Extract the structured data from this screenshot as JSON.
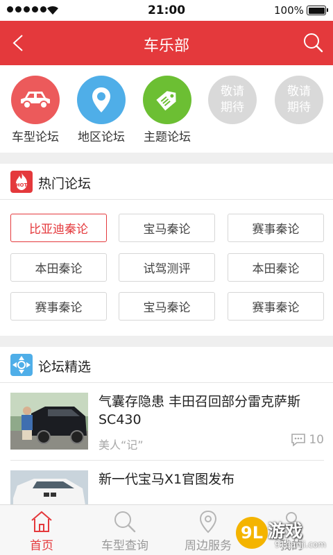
{
  "status_bar": {
    "time": "21:00",
    "battery_percent": "100%",
    "signal_icon": "signal-dots-icon",
    "wifi_icon": "wifi-icon"
  },
  "nav_bar": {
    "title": "车乐部",
    "back_icon": "chevron-left-icon",
    "search_icon": "search-icon",
    "color": "#e4393c"
  },
  "categories": [
    {
      "label": "车型论坛",
      "icon": "car-icon",
      "color": "#ec5a5b"
    },
    {
      "label": "地区论坛",
      "icon": "location-pin-icon",
      "color": "#4faee8"
    },
    {
      "label": "主题论坛",
      "icon": "tag-icon",
      "color": "#6cbf33"
    },
    {
      "label": "敬请期待",
      "line1": "敬请",
      "line2": "期待",
      "icon": "placeholder",
      "color": "#d9d9d9"
    },
    {
      "label": "敬请期待",
      "line1": "敬请",
      "line2": "期待",
      "icon": "placeholder",
      "color": "#d9d9d9"
    }
  ],
  "hot_forums": {
    "title": "热门论坛",
    "icon": "hot-badge-icon",
    "icon_text": "HOT",
    "tags": [
      {
        "label": "比亚迪秦论",
        "active": true
      },
      {
        "label": "宝马秦论",
        "active": false
      },
      {
        "label": "赛事秦论",
        "active": false
      },
      {
        "label": "本田秦论",
        "active": false
      },
      {
        "label": "试驾测评",
        "active": false
      },
      {
        "label": "本田秦论",
        "active": false
      },
      {
        "label": "赛事秦论",
        "active": false
      },
      {
        "label": "宝马秦论",
        "active": false
      },
      {
        "label": "赛事秦论",
        "active": false
      }
    ]
  },
  "forum_picks": {
    "title": "论坛精选",
    "icon": "compass-grid-icon",
    "articles": [
      {
        "headline": "气囊存隐患 丰田召回部分雷克萨斯SC430",
        "source": "美人“记”",
        "comments": "10",
        "thumbnail": "black-suv-photo"
      },
      {
        "headline": "新一代宝马X1官图发布",
        "thumbnail": "white-bmw-photo"
      }
    ]
  },
  "tab_bar": {
    "tabs": [
      {
        "label": "首页",
        "icon": "home-icon",
        "active": true
      },
      {
        "label": "车型查询",
        "icon": "search-icon",
        "active": false
      },
      {
        "label": "周边服务",
        "icon": "location-pin-icon",
        "active": false
      },
      {
        "label": "我的",
        "icon": "user-icon",
        "active": false
      }
    ]
  },
  "watermark": {
    "badge": "9L",
    "text": "游戏",
    "url": "91danji.com"
  }
}
